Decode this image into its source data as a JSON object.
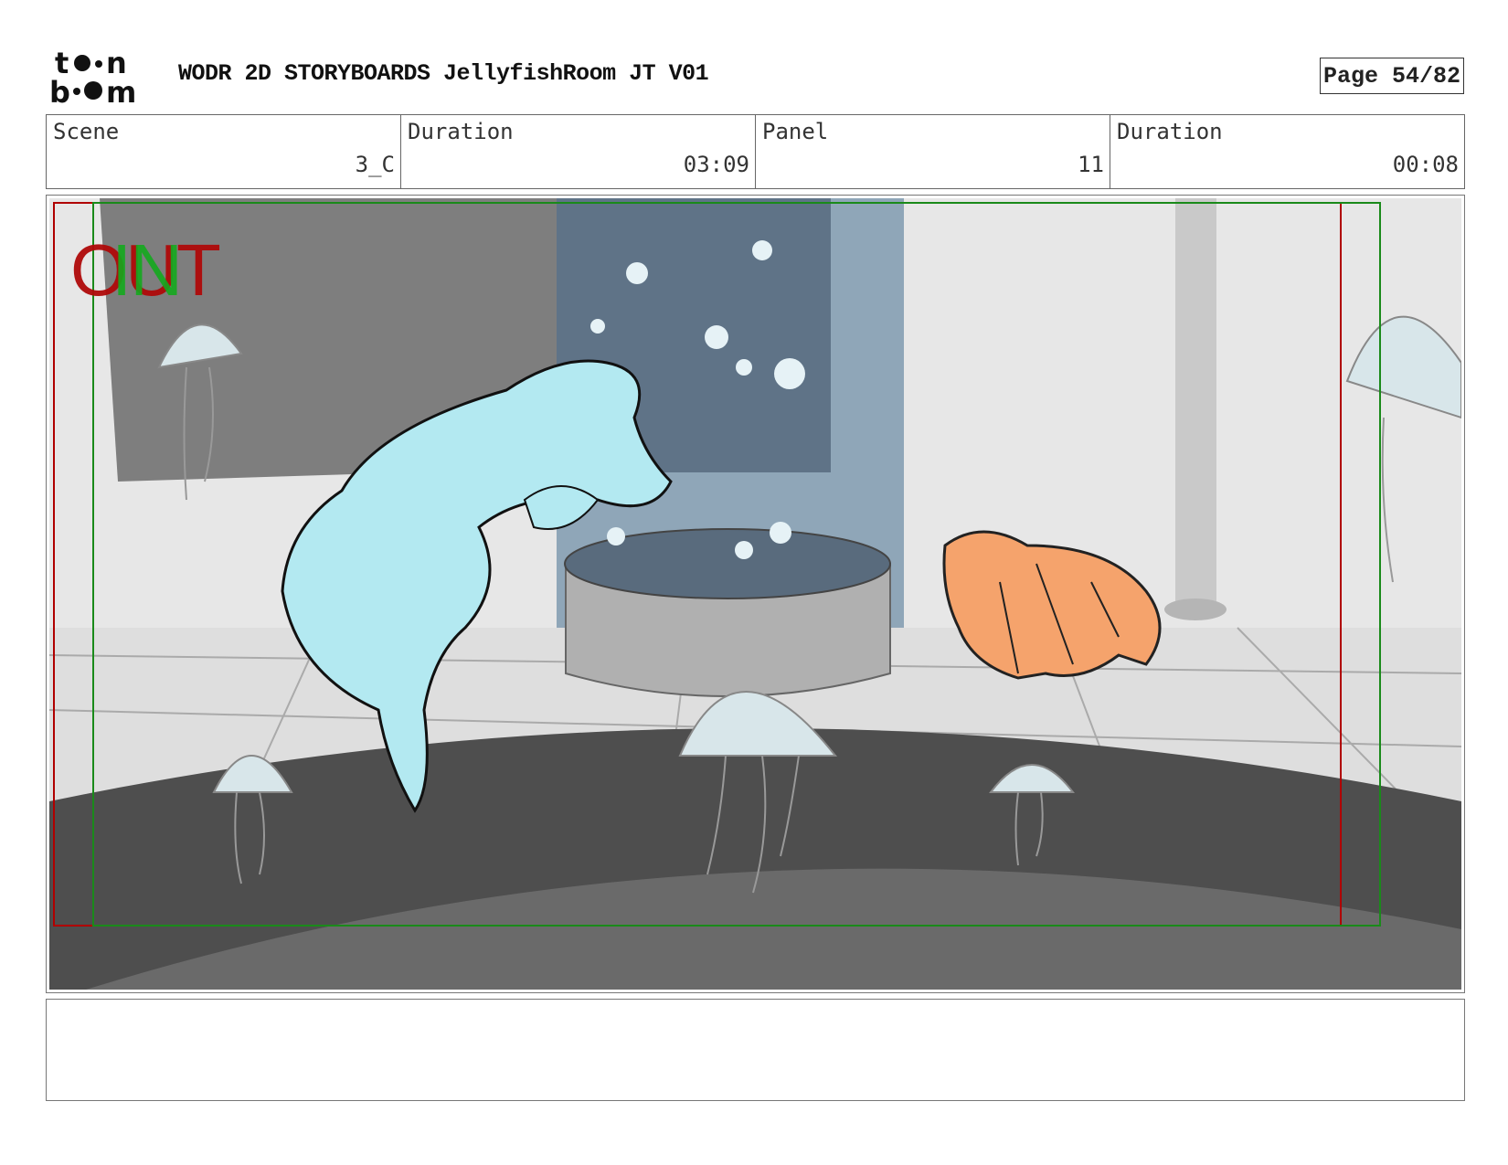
{
  "header": {
    "logo_text": "toon boom",
    "title": "WODR 2D STORYBOARDS JellyfishRoom JT V01",
    "page": "Page 54/82"
  },
  "info": {
    "scene_label": "Scene",
    "scene_value": "3_C",
    "scene_duration_label": "Duration",
    "scene_duration_value": "03:09",
    "panel_label": "Panel",
    "panel_value": "11",
    "panel_duration_label": "Duration",
    "panel_duration_value": "00:08"
  },
  "panel": {
    "overlay_out": "OUT",
    "overlay_in": "IN",
    "colors": {
      "out_frame": "#b00000",
      "in_frame": "#1a8a1a",
      "otter": "#b3e9f1",
      "character": "#f5a36c"
    }
  },
  "notes": {
    "text": ""
  }
}
